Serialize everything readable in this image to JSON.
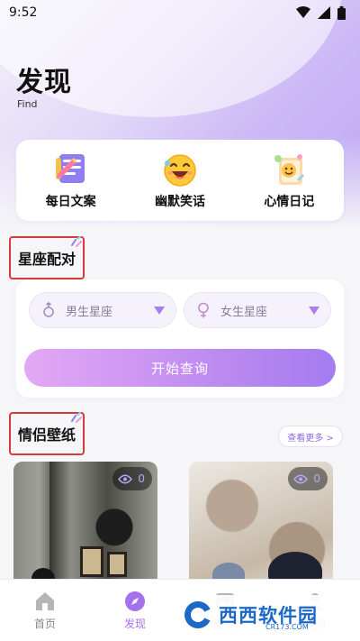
{
  "status": {
    "time": "9:52"
  },
  "header": {
    "title": "发现",
    "subtitle": "Find"
  },
  "quick_actions": [
    {
      "label": "每日文案",
      "icon": "notebook-pen-icon"
    },
    {
      "label": "幽默笑话",
      "icon": "laughing-emoji-icon"
    },
    {
      "label": "心情日记",
      "icon": "mood-diary-icon"
    }
  ],
  "zodiac": {
    "title": "星座配对",
    "male_placeholder": "男生星座",
    "female_placeholder": "女生星座",
    "button": "开始查询"
  },
  "wallpapers": {
    "title": "情侣壁纸",
    "more": "查看更多 >",
    "items": [
      {
        "views": "0"
      },
      {
        "views": "0"
      }
    ]
  },
  "tabs": [
    {
      "label": "首页",
      "active": false
    },
    {
      "label": "发现",
      "active": true
    },
    {
      "label": "壁纸",
      "active": false
    },
    {
      "label": "我的",
      "active": false
    }
  ],
  "watermark": {
    "brand": "西西软件园",
    "url": "CR173.COM"
  },
  "colors": {
    "accent": "#a571ee",
    "highlight_box": "#d63a3a"
  }
}
